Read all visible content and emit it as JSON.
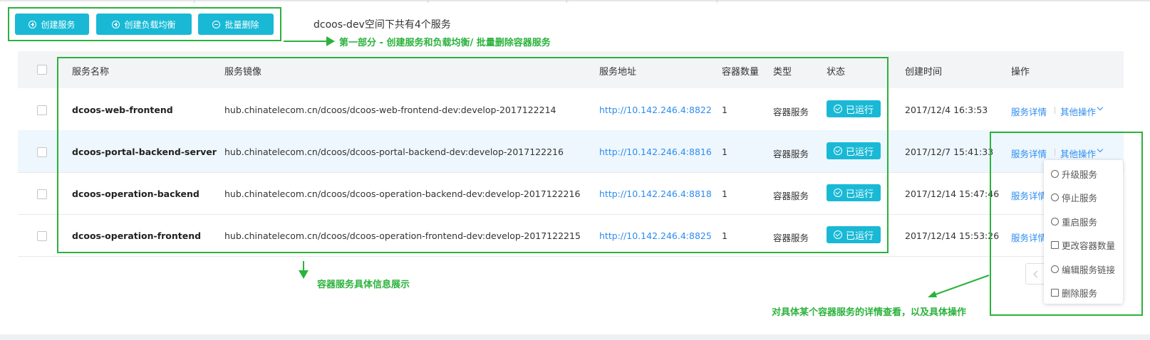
{
  "toolbar": {
    "create_service": "创建服务",
    "create_lb": "创建负载均衡",
    "batch_delete": "批量删除",
    "count_text": "dcoos-dev空间下共有4个服务"
  },
  "annotations": {
    "part1": "第一部分 - 创建服务和负载均衡/ 批量删除容器服务",
    "detail_info": "容器服务具体信息展示",
    "ops_info": "对具体某个容器服务的详情查看，以及具体操作"
  },
  "table": {
    "headers": {
      "name": "服务名称",
      "image": "服务镜像",
      "address": "服务地址",
      "count": "容器数量",
      "type": "类型",
      "status": "状态",
      "created": "创建时间",
      "ops": "操作"
    },
    "rows": [
      {
        "name": "dcoos-web-frontend",
        "image": "hub.chinatelecom.cn/dcoos/dcoos-web-frontend-dev:develop-2017122214",
        "address": "http://10.142.246.4:8822",
        "count": "1",
        "type": "容器服务",
        "status": "已运行",
        "created": "2017/12/4 16:3:53",
        "detail": "服务详情",
        "more": "其他操作"
      },
      {
        "name": "dcoos-portal-backend-server",
        "image": "hub.chinatelecom.cn/dcoos/dcoos-portal-backend-dev:develop-2017122216",
        "address": "http://10.142.246.4:8816",
        "count": "1",
        "type": "容器服务",
        "status": "已运行",
        "created": "2017/12/7 15:41:33",
        "detail": "服务详情",
        "more": "其他操作"
      },
      {
        "name": "dcoos-operation-backend",
        "image": "hub.chinatelecom.cn/dcoos/dcoos-operation-backend-dev:develop-2017122216",
        "address": "http://10.142.246.4:8818",
        "count": "1",
        "type": "容器服务",
        "status": "已运行",
        "created": "2017/12/14 15:47:46",
        "detail": "服务详情"
      },
      {
        "name": "dcoos-operation-frontend",
        "image": "hub.chinatelecom.cn/dcoos/dcoos-operation-frontend-dev:develop-2017122215",
        "address": "http://10.142.246.4:8825",
        "count": "1",
        "type": "容器服务",
        "status": "已运行",
        "created": "2017/12/14 15:53:26",
        "detail": "服务详情"
      }
    ]
  },
  "dropdown": {
    "items": [
      {
        "label": "升级服务",
        "icon": "upgrade-icon"
      },
      {
        "label": "停止服务",
        "icon": "power-icon"
      },
      {
        "label": "重启服务",
        "icon": "restart-icon"
      },
      {
        "label": "更改容器数量",
        "icon": "edit-icon"
      },
      {
        "label": "编辑服务链接",
        "icon": "gear-icon"
      },
      {
        "label": "删除服务",
        "icon": "trash-icon"
      }
    ]
  },
  "colors": {
    "accent": "#19b9d6",
    "link": "#2d8cf0",
    "annotation_green": "#2bb23c",
    "header_bg": "#f2f4f6",
    "selected_row_bg": "#eef7fd"
  }
}
